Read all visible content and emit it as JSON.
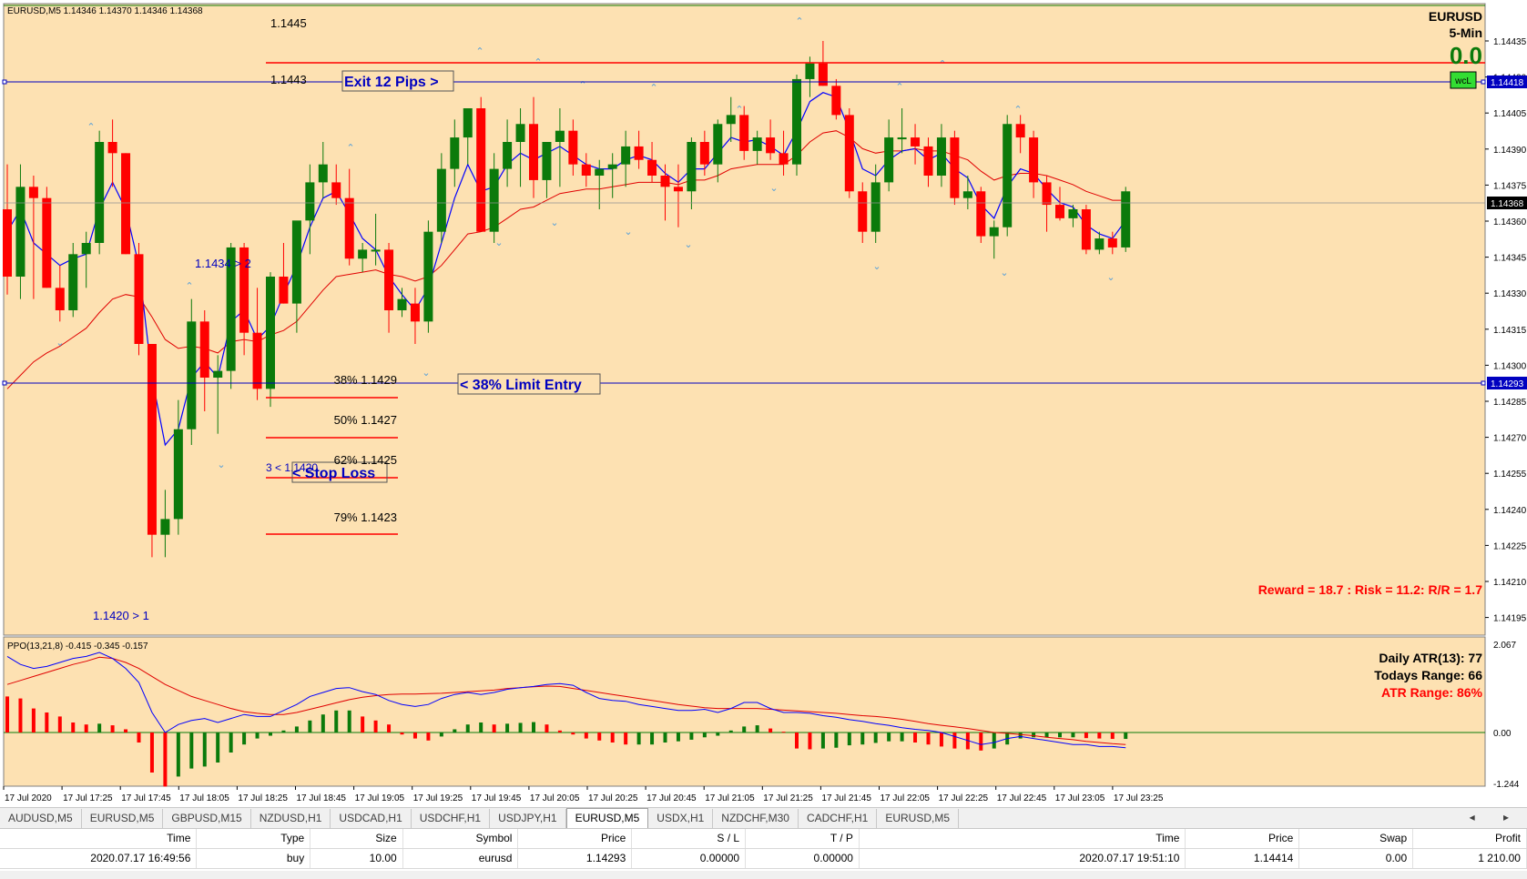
{
  "chart_header": {
    "symbol_info": "EURUSD,M5  1.14346 1.14370 1.14346 1.14368",
    "pair": "EURUSD",
    "timeframe": "5-Min",
    "pips_value": "0.0",
    "wcl_badge": "wcL"
  },
  "colors": {
    "background": "#fde1b2",
    "bull": "#0b7a0b",
    "bear": "#ff0000",
    "ma_fast": "#0000ff",
    "ma_slow": "#e00000",
    "level_line": "#0000c0",
    "fib_line": "#ff0000"
  },
  "price_axis": {
    "labels": [
      "1.14435",
      "1.14420",
      "1.14405",
      "1.14390",
      "1.14375",
      "1.14360",
      "1.14345",
      "1.14330",
      "1.14315",
      "1.14300",
      "1.14285",
      "1.14270",
      "1.14255",
      "1.14240",
      "1.14225",
      "1.14210",
      "1.14195"
    ],
    "tags": {
      "exit_level": "1.14418",
      "current": "1.14368",
      "entry_level": "1.14293"
    }
  },
  "time_axis": {
    "labels": [
      "17 Jul 2020",
      "17 Jul 17:25",
      "17 Jul 17:45",
      "17 Jul 18:05",
      "17 Jul 18:25",
      "17 Jul 18:45",
      "17 Jul 19:05",
      "17 Jul 19:25",
      "17 Jul 19:45",
      "17 Jul 20:05",
      "17 Jul 20:25",
      "17 Jul 20:45",
      "17 Jul 21:05",
      "17 Jul 21:25",
      "17 Jul 21:45",
      "17 Jul 22:05",
      "17 Jul 22:25",
      "17 Jul 22:45",
      "17 Jul 23:05",
      "17 Jul 23:25"
    ]
  },
  "annotations": {
    "level_1445": "1.1445",
    "level_1443": "1.1443",
    "exit_label": "Exit 12 Pips >",
    "entry_label": "< 38% Limit Entry",
    "stop_label": "< Stop Loss",
    "stop_prefix": "3 < 1.1420",
    "swing_high_label": "1.1434 > 2",
    "swing_low_label": "1.1420 > 1",
    "fib_38": "38% 1.1429",
    "fib_50": "50% 1.1427",
    "fib_62": "62% 1.1425",
    "fib_79": "79% 1.1423",
    "reward_risk": "Reward = 18.7 : Risk = 11.2: R/R = 1.7"
  },
  "indicator": {
    "title": "PPO(13,21,8) -0.415 -0.345 -0.157",
    "axis_labels": [
      "2.067",
      "0.00",
      "-1.244"
    ],
    "daily_atr": "Daily ATR(13): 77",
    "todays_range": "Todays Range: 66",
    "atr_range": "ATR Range: 86%"
  },
  "tabs": [
    "AUDUSD,M5",
    "EURUSD,M5",
    "GBPUSD,M15",
    "NZDUSD,H1",
    "USDCAD,H1",
    "USDCHF,H1",
    "USDJPY,H1",
    "EURUSD,M5",
    "USDX,H1",
    "NZDCHF,M30",
    "CADCHF,H1",
    "EURUSD,M5"
  ],
  "active_tab_index": 7,
  "tab_nav": "◂ ▸",
  "trades": {
    "headers": [
      "Time",
      "Type",
      "Size",
      "Symbol",
      "Price",
      "S / L",
      "T / P",
      "Time",
      "Price",
      "Swap",
      "Profit"
    ],
    "rows": [
      [
        "2020.07.17 16:49:56",
        "buy",
        "10.00",
        "eurusd",
        "1.14293",
        "0.00000",
        "0.00000",
        "2020.07.17 19:51:10",
        "1.14414",
        "0.00",
        "1 210.00"
      ]
    ]
  },
  "chart_data": {
    "type": "candlestick",
    "price_range": [
      1.1419,
      1.14445
    ],
    "candles": [
      [
        1.1436,
        1.1438,
        1.14322,
        1.1433
      ],
      [
        1.1433,
        1.1438,
        1.1432,
        1.1437
      ],
      [
        1.1437,
        1.14375,
        1.1432,
        1.14365
      ],
      [
        1.14365,
        1.1437,
        1.14325,
        1.14325
      ],
      [
        1.14325,
        1.14335,
        1.1431,
        1.14315
      ],
      [
        1.14315,
        1.14345,
        1.14312,
        1.1434
      ],
      [
        1.1434,
        1.1435,
        1.14325,
        1.14345
      ],
      [
        1.14345,
        1.14395,
        1.1434,
        1.1439
      ],
      [
        1.1439,
        1.144,
        1.1437,
        1.14385
      ],
      [
        1.14385,
        1.14385,
        1.1434,
        1.1434
      ],
      [
        1.1434,
        1.14345,
        1.14295,
        1.143
      ],
      [
        1.143,
        1.143,
        1.14205,
        1.14215
      ],
      [
        1.14215,
        1.14235,
        1.14205,
        1.14222
      ],
      [
        1.14222,
        1.14275,
        1.14215,
        1.14262
      ],
      [
        1.14262,
        1.1432,
        1.14255,
        1.1431
      ],
      [
        1.1431,
        1.14315,
        1.1427,
        1.14285
      ],
      [
        1.14285,
        1.14295,
        1.1426,
        1.14288
      ],
      [
        1.14288,
        1.14345,
        1.1428,
        1.14343
      ],
      [
        1.14343,
        1.14345,
        1.14295,
        1.14305
      ],
      [
        1.14305,
        1.14325,
        1.14275,
        1.1428
      ],
      [
        1.1428,
        1.14332,
        1.14272,
        1.1433
      ],
      [
        1.1433,
        1.14345,
        1.14318,
        1.14318
      ],
      [
        1.14318,
        1.14342,
        1.14305,
        1.14355
      ],
      [
        1.14355,
        1.1438,
        1.1434,
        1.14372
      ],
      [
        1.14372,
        1.1439,
        1.14365,
        1.1438
      ],
      [
        1.14372,
        1.1438,
        1.14362,
        1.14365
      ],
      [
        1.14365,
        1.14378,
        1.14335,
        1.14338
      ],
      [
        1.14338,
        1.14345,
        1.14332,
        1.14342
      ],
      [
        1.14342,
        1.14358,
        1.14335,
        1.14342
      ],
      [
        1.14342,
        1.14345,
        1.14305,
        1.14315
      ],
      [
        1.14315,
        1.14325,
        1.14312,
        1.1432
      ],
      [
        1.14318,
        1.14325,
        1.143,
        1.1431
      ],
      [
        1.1431,
        1.14355,
        1.14305,
        1.1435
      ],
      [
        1.1435,
        1.14385,
        1.14345,
        1.14378
      ],
      [
        1.14378,
        1.144,
        1.1437,
        1.14392
      ],
      [
        1.14392,
        1.144,
        1.1438,
        1.14405
      ],
      [
        1.14405,
        1.1441,
        1.1435,
        1.1435
      ],
      [
        1.1435,
        1.14385,
        1.14345,
        1.14378
      ],
      [
        1.14378,
        1.144,
        1.1437,
        1.1439
      ],
      [
        1.1439,
        1.14405,
        1.1437,
        1.14398
      ],
      [
        1.14398,
        1.1441,
        1.14365,
        1.14373
      ],
      [
        1.14373,
        1.1439,
        1.14365,
        1.1439
      ],
      [
        1.1439,
        1.14405,
        1.1437,
        1.14395
      ],
      [
        1.14395,
        1.144,
        1.14375,
        1.1438
      ],
      [
        1.1438,
        1.14385,
        1.1437,
        1.14375
      ],
      [
        1.14375,
        1.14382,
        1.1436,
        1.14378
      ],
      [
        1.14378,
        1.14385,
        1.14365,
        1.1438
      ],
      [
        1.1438,
        1.14395,
        1.1437,
        1.14388
      ],
      [
        1.14388,
        1.14395,
        1.14378,
        1.14382
      ],
      [
        1.14382,
        1.1439,
        1.14372,
        1.14375
      ],
      [
        1.14375,
        1.1438,
        1.14355,
        1.1437
      ],
      [
        1.1437,
        1.1438,
        1.14352,
        1.14368
      ],
      [
        1.14368,
        1.14392,
        1.1436,
        1.1439
      ],
      [
        1.1439,
        1.14395,
        1.14375,
        1.1438
      ],
      [
        1.1438,
        1.144,
        1.14372,
        1.14398
      ],
      [
        1.14398,
        1.1441,
        1.1439,
        1.14402
      ],
      [
        1.14402,
        1.14406,
        1.14382,
        1.14386
      ],
      [
        1.14386,
        1.14395,
        1.1438,
        1.14392
      ],
      [
        1.14392,
        1.144,
        1.14382,
        1.14385
      ],
      [
        1.14385,
        1.14395,
        1.14375,
        1.1438
      ],
      [
        1.1438,
        1.1442,
        1.14375,
        1.14418
      ],
      [
        1.14418,
        1.14428,
        1.1441,
        1.14425
      ],
      [
        1.14425,
        1.14435,
        1.14415,
        1.14415
      ],
      [
        1.14415,
        1.14418,
        1.144,
        1.14402
      ],
      [
        1.14402,
        1.14405,
        1.14365,
        1.14368
      ],
      [
        1.14368,
        1.14372,
        1.14345,
        1.1435
      ],
      [
        1.1435,
        1.1438,
        1.14345,
        1.14372
      ],
      [
        1.14372,
        1.144,
        1.14368,
        1.14392
      ],
      [
        1.14392,
        1.14405,
        1.14385,
        1.14392
      ],
      [
        1.14392,
        1.14398,
        1.1438,
        1.14388
      ],
      [
        1.14388,
        1.14392,
        1.1437,
        1.14375
      ],
      [
        1.14375,
        1.14398,
        1.1437,
        1.14392
      ],
      [
        1.14392,
        1.14395,
        1.14362,
        1.14365
      ],
      [
        1.14365,
        1.14375,
        1.1436,
        1.14368
      ],
      [
        1.14368,
        1.1437,
        1.14345,
        1.14348
      ],
      [
        1.14348,
        1.14355,
        1.14338,
        1.14352
      ],
      [
        1.14352,
        1.14402,
        1.14348,
        1.14398
      ],
      [
        1.14398,
        1.14402,
        1.14385,
        1.14392
      ],
      [
        1.14392,
        1.14395,
        1.14365,
        1.14372
      ],
      [
        1.14372,
        1.14375,
        1.1435,
        1.14362
      ],
      [
        1.14362,
        1.1437,
        1.14355,
        1.14356
      ],
      [
        1.14356,
        1.14362,
        1.14352,
        1.1436
      ],
      [
        1.1436,
        1.14362,
        1.1434,
        1.14342
      ],
      [
        1.14342,
        1.1435,
        1.1434,
        1.14347
      ],
      [
        1.14347,
        1.1435,
        1.1434,
        1.14343
      ],
      [
        1.14343,
        1.1437,
        1.14341,
        1.14368
      ]
    ],
    "ma_fast": [
      1.1435,
      1.1436,
      1.14345,
      1.1434,
      1.14335,
      1.14338,
      1.1434,
      1.1436,
      1.14372,
      1.1436,
      1.14335,
      1.14285,
      1.14255,
      1.14262,
      1.14285,
      1.14292,
      1.14285,
      1.1431,
      1.14315,
      1.14302,
      1.14308,
      1.14322,
      1.14335,
      1.14352,
      1.14365,
      1.14368,
      1.14358,
      1.14347,
      1.14342,
      1.1433,
      1.14322,
      1.14315,
      1.14325,
      1.14345,
      1.14365,
      1.1438,
      1.14368,
      1.1437,
      1.1438,
      1.14385,
      1.14382,
      1.14385,
      1.14388,
      1.14384,
      1.1438,
      1.14378,
      1.14378,
      1.14382,
      1.14384,
      1.14382,
      1.14376,
      1.14372,
      1.14378,
      1.14378,
      1.14385,
      1.14392,
      1.1439,
      1.14391,
      1.14388,
      1.14384,
      1.14395,
      1.14408,
      1.14412,
      1.1441,
      1.14395,
      1.14378,
      1.14375,
      1.14382,
      1.14386,
      1.14387,
      1.14382,
      1.14385,
      1.14378,
      1.14374,
      1.14362,
      1.14356,
      1.1437,
      1.14378,
      1.14376,
      1.14369,
      1.14363,
      1.14361,
      1.14353,
      1.14349,
      1.14347,
      1.14355
    ],
    "ma_slow": [
      1.1428,
      1.14286,
      1.14292,
      1.14296,
      1.14299,
      1.14303,
      1.14307,
      1.14314,
      1.1432,
      1.14322,
      1.14321,
      1.14312,
      1.14302,
      1.14298,
      1.14299,
      1.14298,
      1.14296,
      1.14301,
      1.14302,
      1.14301,
      1.14304,
      1.14306,
      1.1431,
      1.14317,
      1.14324,
      1.1433,
      1.14331,
      1.14332,
      1.14333,
      1.14331,
      1.1433,
      1.14328,
      1.1433,
      1.14335,
      1.14342,
      1.14349,
      1.1435,
      1.14352,
      1.14356,
      1.1436,
      1.14361,
      1.14364,
      1.14367,
      1.14368,
      1.14369,
      1.14369,
      1.1437,
      1.14371,
      1.14372,
      1.14372,
      1.14372,
      1.14371,
      1.14373,
      1.14373,
      1.14375,
      1.14378,
      1.14379,
      1.1438,
      1.1438,
      1.1438,
      1.14384,
      1.1439,
      1.14394,
      1.14395,
      1.14392,
      1.14387,
      1.14385,
      1.14386,
      1.14386,
      1.14387,
      1.14386,
      1.14386,
      1.14384,
      1.14382,
      1.14377,
      1.14373,
      1.14375,
      1.14376,
      1.14376,
      1.14375,
      1.14373,
      1.14371,
      1.14368,
      1.14366,
      1.14364,
      1.14364
    ],
    "ppo_histogram": [
      0.9,
      0.85,
      0.6,
      0.5,
      0.4,
      0.25,
      0.2,
      0.22,
      0.18,
      0.08,
      -0.25,
      -1.0,
      -1.35,
      -1.1,
      -0.9,
      -0.85,
      -0.75,
      -0.5,
      -0.3,
      -0.15,
      -0.08,
      0.05,
      0.15,
      0.3,
      0.45,
      0.55,
      0.55,
      0.4,
      0.3,
      0.2,
      -0.05,
      -0.15,
      -0.2,
      -0.1,
      0.08,
      0.2,
      0.25,
      0.2,
      0.22,
      0.24,
      0.26,
      0.2,
      0.05,
      -0.05,
      -0.15,
      -0.2,
      -0.25,
      -0.3,
      -0.3,
      -0.3,
      -0.25,
      -0.22,
      -0.18,
      -0.12,
      -0.08,
      0.05,
      0.15,
      0.18,
      0.1,
      0.02,
      -0.4,
      -0.42,
      -0.4,
      -0.38,
      -0.32,
      -0.3,
      -0.26,
      -0.22,
      -0.22,
      -0.25,
      -0.3,
      -0.35,
      -0.4,
      -0.42,
      -0.45,
      -0.4,
      -0.3,
      -0.15,
      -0.12,
      -0.12,
      -0.12,
      -0.12,
      -0.14,
      -0.15,
      -0.16,
      -0.16
    ],
    "ppo_line": [
      1.9,
      1.7,
      1.6,
      1.65,
      1.75,
      1.85,
      1.9,
      2.0,
      1.85,
      1.6,
      1.25,
      0.5,
      0.0,
      0.2,
      0.3,
      0.35,
      0.25,
      0.35,
      0.45,
      0.4,
      0.4,
      0.55,
      0.7,
      0.9,
      1.0,
      1.1,
      1.12,
      1.02,
      0.95,
      0.8,
      0.7,
      0.65,
      0.7,
      0.85,
      0.95,
      1.0,
      0.95,
      1.0,
      1.08,
      1.12,
      1.15,
      1.2,
      1.22,
      1.18,
      1.0,
      0.85,
      0.8,
      0.78,
      0.7,
      0.65,
      0.6,
      0.55,
      0.55,
      0.58,
      0.5,
      0.6,
      0.75,
      0.75,
      0.6,
      0.5,
      0.5,
      0.48,
      0.42,
      0.38,
      0.32,
      0.28,
      0.22,
      0.18,
      0.12,
      0.08,
      0.05,
      0.0,
      -0.1,
      -0.2,
      -0.3,
      -0.25,
      -0.15,
      -0.1,
      -0.15,
      -0.2,
      -0.25,
      -0.3,
      -0.3,
      -0.35,
      -0.35,
      -0.38
    ],
    "ppo_signal": [
      1.2,
      1.3,
      1.4,
      1.5,
      1.6,
      1.7,
      1.78,
      1.88,
      1.85,
      1.75,
      1.6,
      1.4,
      1.2,
      1.05,
      0.9,
      0.8,
      0.7,
      0.6,
      0.52,
      0.48,
      0.45,
      0.45,
      0.5,
      0.58,
      0.66,
      0.74,
      0.82,
      0.88,
      0.92,
      0.95,
      0.96,
      0.96,
      0.97,
      0.98,
      1.0,
      1.02,
      1.04,
      1.06,
      1.1,
      1.12,
      1.14,
      1.16,
      1.15,
      1.1,
      1.05,
      1.0,
      0.95,
      0.9,
      0.85,
      0.8,
      0.75,
      0.7,
      0.66,
      0.62,
      0.6,
      0.6,
      0.6,
      0.6,
      0.58,
      0.56,
      0.54,
      0.52,
      0.5,
      0.48,
      0.45,
      0.42,
      0.4,
      0.37,
      0.33,
      0.28,
      0.22,
      0.18,
      0.14,
      0.1,
      0.05,
      0.0,
      -0.02,
      -0.05,
      -0.08,
      -0.12,
      -0.15,
      -0.18,
      -0.22,
      -0.25,
      -0.28,
      -0.3
    ],
    "up_arrows": [
      15,
      31,
      44,
      59,
      69,
      79,
      82,
      89,
      99,
      124,
      133,
      139,
      152
    ],
    "down_arrows": [
      8,
      18,
      27,
      35,
      53,
      65,
      70,
      86,
      90,
      114,
      122,
      143
    ]
  }
}
